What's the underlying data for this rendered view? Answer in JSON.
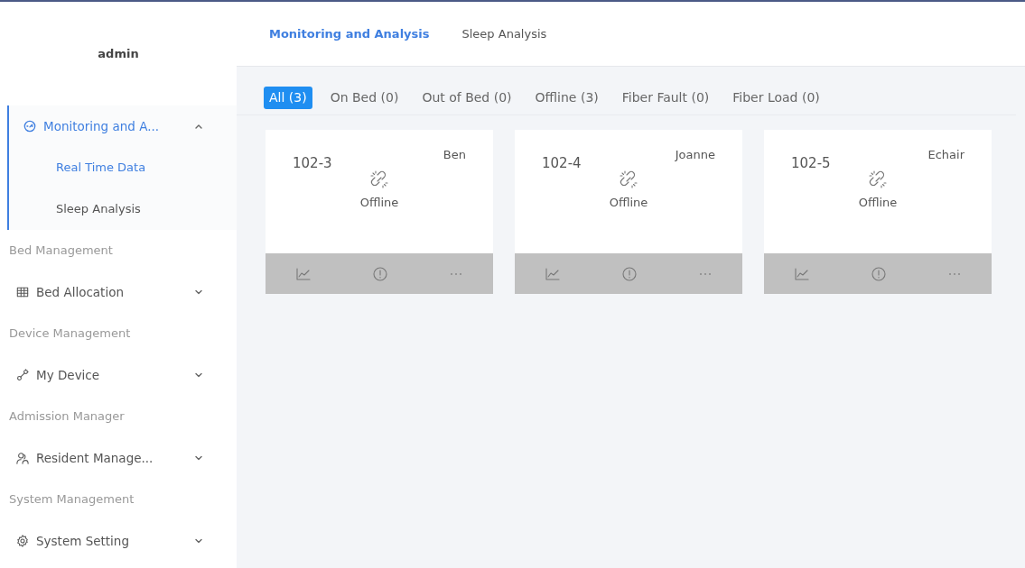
{
  "sidebar": {
    "user": "admin",
    "items": [
      {
        "kind": "group",
        "label": "Monitoring and A...",
        "expanded": true,
        "selected": true,
        "children": [
          {
            "label": "Real Time Data",
            "selected": true
          },
          {
            "label": "Sleep Analysis",
            "selected": false
          }
        ]
      },
      {
        "kind": "section",
        "label": "Bed Management"
      },
      {
        "kind": "group",
        "label": "Bed Allocation",
        "expanded": false,
        "selected": false
      },
      {
        "kind": "section",
        "label": "Device Management"
      },
      {
        "kind": "group",
        "label": "My Device",
        "expanded": false,
        "selected": false
      },
      {
        "kind": "section",
        "label": "Admission Manager"
      },
      {
        "kind": "group",
        "label": "Resident Manage...",
        "expanded": false,
        "selected": false
      },
      {
        "kind": "section",
        "label": "System Management"
      },
      {
        "kind": "group",
        "label": "System Setting",
        "expanded": false,
        "selected": false
      }
    ]
  },
  "tabs": [
    {
      "label": "Monitoring and Analysis",
      "selected": true
    },
    {
      "label": "Sleep Analysis",
      "selected": false
    }
  ],
  "filters": [
    {
      "label": "All (3)",
      "selected": true
    },
    {
      "label": "On Bed (0)",
      "selected": false
    },
    {
      "label": "Out of Bed (0)",
      "selected": false
    },
    {
      "label": "Offline (3)",
      "selected": false
    },
    {
      "label": "Fiber Fault (0)",
      "selected": false
    },
    {
      "label": "Fiber Load (0)",
      "selected": false
    }
  ],
  "beds": [
    {
      "bed": "102-3",
      "resident": "Ben",
      "status": "Offline"
    },
    {
      "bed": "102-4",
      "resident": "Joanne",
      "status": "Offline"
    },
    {
      "bed": "102-5",
      "resident": "Echair",
      "status": "Offline"
    }
  ]
}
